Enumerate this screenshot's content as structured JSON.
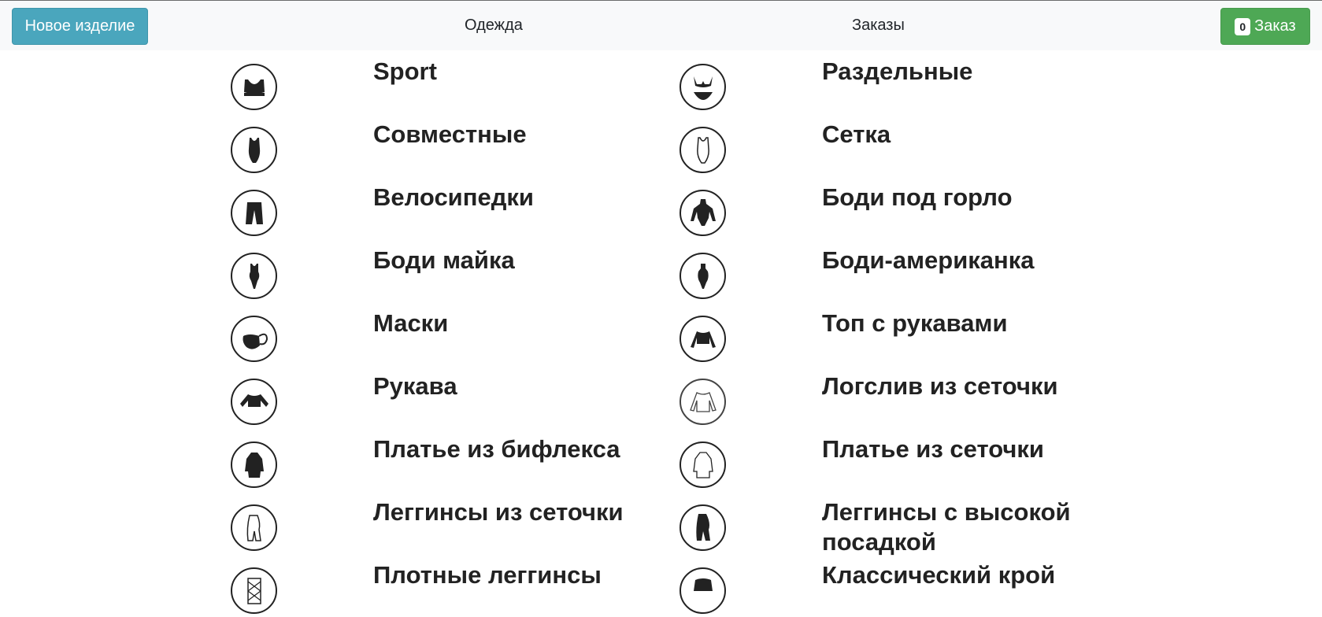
{
  "navbar": {
    "new_item_label": "Новое изделие",
    "clothes_label": "Одежда",
    "orders_label": "Заказы",
    "order_count": "0",
    "order_label": "Заказ"
  },
  "colors": {
    "info": "#4aa6bd",
    "success": "#4ea855",
    "navbar_bg": "#f8f9fa"
  },
  "items": {
    "left": [
      {
        "label": "Sport",
        "icon": "sports-bra-icon"
      },
      {
        "label": "Совместные",
        "icon": "swimsuit-icon"
      },
      {
        "label": "Велосипедки",
        "icon": "bike-shorts-icon"
      },
      {
        "label": "Боди майка",
        "icon": "tank-bodysuit-icon"
      },
      {
        "label": "Маски",
        "icon": "face-mask-icon"
      },
      {
        "label": "Рукава",
        "icon": "sleeves-crop-top-icon"
      },
      {
        "label": "Платье из бифлекса",
        "icon": "biflex-dress-icon"
      },
      {
        "label": "Леггинсы из сеточки",
        "icon": "mesh-leggings-icon"
      },
      {
        "label": "Плотные леггинсы",
        "icon": "fishnet-leggings-icon"
      }
    ],
    "right": [
      {
        "label": "Раздельные",
        "icon": "bikini-icon"
      },
      {
        "label": "Сетка",
        "icon": "mesh-swimsuit-icon"
      },
      {
        "label": "Боди под горло",
        "icon": "turtleneck-bodysuit-icon"
      },
      {
        "label": "Боди-американка",
        "icon": "halter-bodysuit-icon"
      },
      {
        "label": "Топ с рукавами",
        "icon": "long-sleeve-top-icon"
      },
      {
        "label": "Логслив из сеточки",
        "icon": "mesh-longsleeve-icon"
      },
      {
        "label": "Платье из сеточки",
        "icon": "mesh-dress-icon"
      },
      {
        "label": "Леггинсы с высокой посадкой",
        "icon": "high-waist-leggings-icon"
      },
      {
        "label": "Классический крой",
        "icon": "classic-cut-icon"
      }
    ]
  }
}
